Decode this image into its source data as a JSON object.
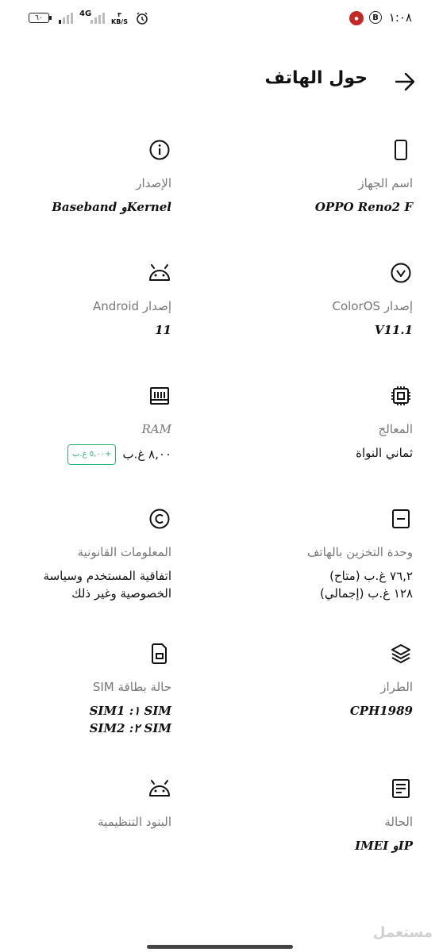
{
  "status_bar": {
    "battery": "٦٠",
    "network": "4G",
    "speed_value": "٣",
    "speed_unit": "KB/S",
    "time": "١:٠٨"
  },
  "header": {
    "title": "حول الهاتف"
  },
  "items": {
    "device_name": {
      "label": "اسم الجهاز",
      "value": "OPPO Reno2 F",
      "icon": "phone-icon"
    },
    "version": {
      "label": "الإصدار",
      "value": "Kernelو Baseband",
      "icon": "info-icon"
    },
    "coloros": {
      "label": "إصدار ColorOS",
      "value": "V11.1",
      "icon": "coloros-icon"
    },
    "android": {
      "label": "إصدار Android",
      "value": "11",
      "icon": "android-icon"
    },
    "processor": {
      "label": "المعالج",
      "value": "ثماني النواة",
      "icon": "chip-icon"
    },
    "ram": {
      "label": "RAM",
      "value": "٨,٠٠ غ.ب",
      "badge": "+٥,٠٠ غ.ب",
      "icon": "ram-icon"
    },
    "storage": {
      "label": "وحدة التخزين بالهاتف",
      "value_line1": "٧٦,٢ غ.ب  (متاح)",
      "value_line2": "١٢٨ غ.ب  (إجمالي)",
      "icon": "storage-icon"
    },
    "legal": {
      "label": "المعلومات القانونية",
      "value_line1": "اتفاقية المستخدم وسياسة",
      "value_line2": "الخصوصية وغير ذلك",
      "icon": "copyright-icon"
    },
    "model": {
      "label": "الطراز",
      "value": "CPH1989",
      "icon": "layers-icon"
    },
    "sim": {
      "label": "حالة بطاقة SIM",
      "value_line1": "SIM ١: SIM1",
      "value_line2": "SIM ٢: SIM2",
      "icon": "sim-icon"
    },
    "status": {
      "label": "الحالة",
      "value": "IPو IMEI",
      "icon": "document-icon"
    },
    "regulatory": {
      "label": "البنود التنظيمية",
      "icon": "android-icon"
    }
  },
  "watermark": "مستعمل"
}
